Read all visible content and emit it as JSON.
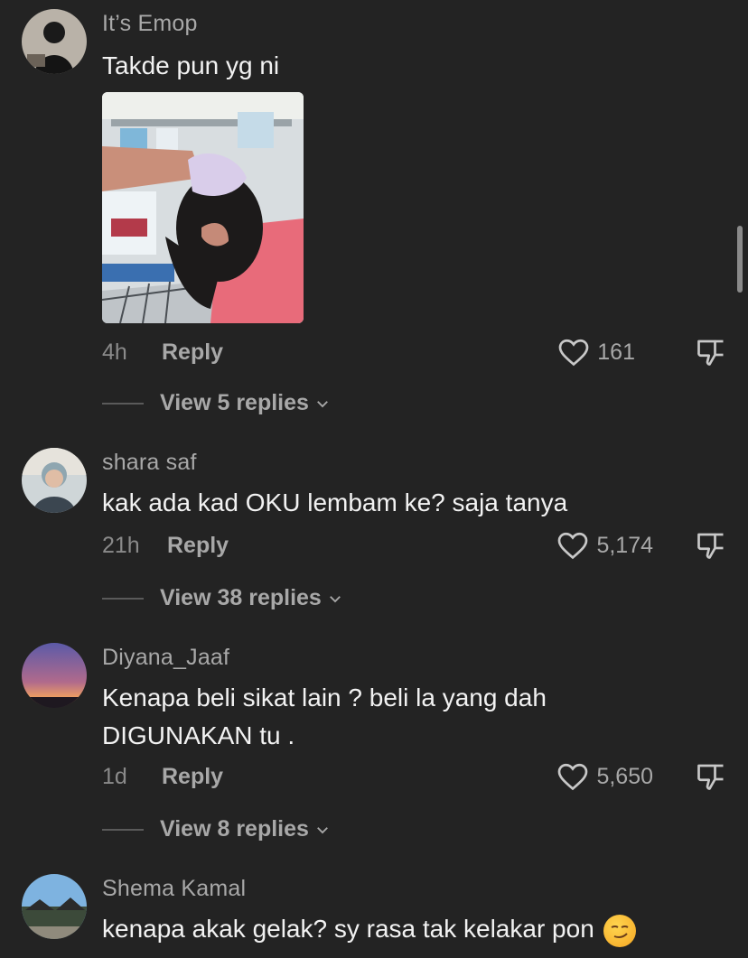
{
  "comments": [
    {
      "username": "It’s Emop",
      "text": "Takde pun yg ni",
      "time": "4h",
      "reply_label": "Reply",
      "likes": "161",
      "view_replies": "View 5 replies",
      "has_image": true
    },
    {
      "username": "shara saf",
      "text": "kak ada kad OKU lembam ke? saja tanya",
      "time": "21h",
      "reply_label": "Reply",
      "likes": "5,174",
      "view_replies": "View 38 replies"
    },
    {
      "username": "Diyana_Jaaf",
      "text": "Kenapa beli sikat lain ? beli la yang dah DIGUNAKAN tu .",
      "time": "1d",
      "reply_label": "Reply",
      "likes": "5,650",
      "view_replies": "View 8 replies"
    },
    {
      "username": "Shema Kamal",
      "text": "kenapa akak gelak? sy rasa tak kelakar pon",
      "emoji": "smirking-face"
    }
  ],
  "colors": {
    "background": "#232323",
    "username": "#a8a8a8",
    "text": "#f2f2f2",
    "muted": "#8a8a8a"
  }
}
